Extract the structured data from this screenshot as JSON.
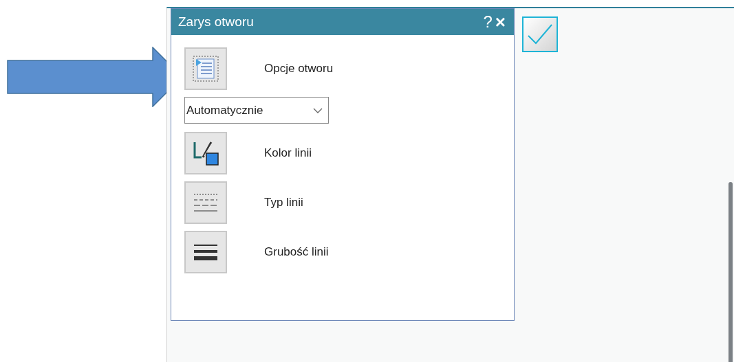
{
  "dialog": {
    "title": "Zarys otworu",
    "help": "?",
    "close": "×",
    "items": [
      {
        "kind": "icon_button",
        "label": "Opcje otworu"
      },
      {
        "kind": "dropdown",
        "value": "Automatycznie"
      },
      {
        "kind": "icon_button",
        "label": "Kolor linii"
      },
      {
        "kind": "icon_button",
        "label": "Typ linii"
      },
      {
        "kind": "icon_button",
        "label": "Grubość linii"
      }
    ]
  }
}
